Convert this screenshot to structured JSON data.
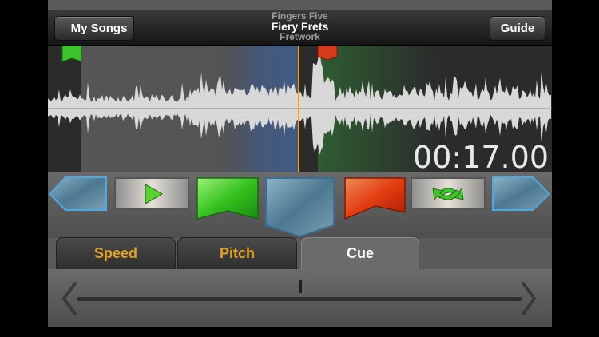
{
  "header": {
    "back_label": "My Songs",
    "guide_label": "Guide",
    "artist": "Fingers Five",
    "song_title": "Fiery Frets",
    "album": "Fretwork"
  },
  "waveform": {
    "timecode": "00:17.00"
  },
  "tabs": [
    {
      "label": "Speed",
      "active": false
    },
    {
      "label": "Pitch",
      "active": false
    },
    {
      "label": "Cue",
      "active": true
    }
  ],
  "colors": {
    "tab_inactive_text": "#e0a020",
    "playhead": "#f0a020",
    "green_marker": "#39c42a",
    "red_marker": "#d63a1a",
    "blue_selection": "#3f5f8f"
  },
  "icons": [
    "back-arrow-icon",
    "play-icon",
    "green-marker-icon",
    "down-marker-icon",
    "red-marker-icon",
    "loop-icon",
    "forward-arrow-icon",
    "left-chevron-icon",
    "right-chevron-icon"
  ]
}
